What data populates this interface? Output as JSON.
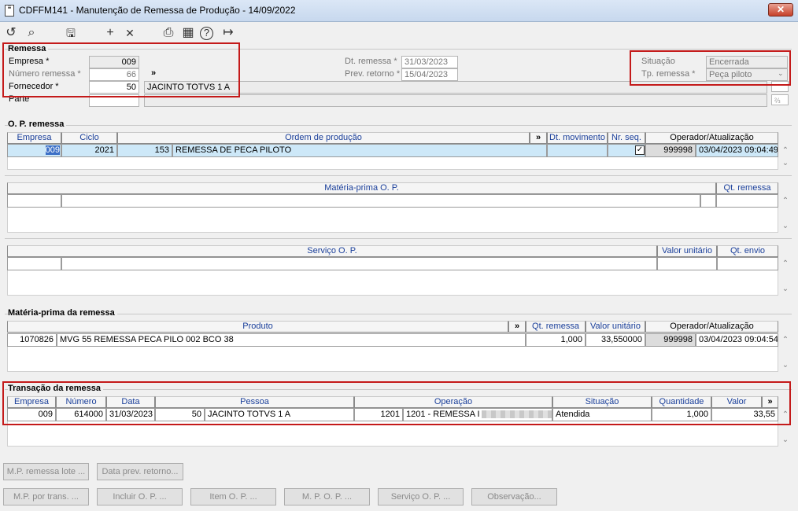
{
  "window": {
    "title": "CDFFM141 - Manutenção de Remessa de Produção - 14/09/2022",
    "close": "✕"
  },
  "toolbar": {
    "undo": "↺",
    "search": "⌕",
    "save": "🖫",
    "add": "+",
    "delete": "✕",
    "print": "⎙",
    "calendar": "▦",
    "help": "?",
    "exit": "↦"
  },
  "remessa": {
    "section": "Remessa",
    "empresa_label": "Empresa *",
    "empresa": "009",
    "numero_label": "Número remessa *",
    "numero": "66",
    "fornecedor_label": "Fornecedor *",
    "fornecedor": "50",
    "fornecedor_nome": "JACINTO TOTVS 1 A",
    "parte_label": "Parte",
    "more": "»",
    "dt_remessa_label": "Dt. remessa *",
    "dt_remessa": "31/03/2023",
    "prev_retorno_label": "Prev. retorno *",
    "prev_retorno": "15/04/2023",
    "situacao_label": "Situação",
    "situacao": "Encerrada",
    "tp_remessa_label": "Tp. remessa *",
    "tp_remessa": "Peça piloto"
  },
  "op_remessa": {
    "section": "O. P. remessa",
    "headers": [
      "Empresa",
      "Ciclo",
      "Ordem de produção",
      "»",
      "Dt. movimento",
      "Nr. seq.",
      "Operador/Atualização"
    ],
    "row": {
      "empresa": "009",
      "ciclo": "2021",
      "ordem": "153",
      "ordem_desc": "REMESSA DE PECA PILOTO",
      "dt_movimento": "",
      "nr_seq_checked": "✓",
      "operador": "999998",
      "atualizacao": "03/04/2023 09:04:49"
    }
  },
  "mp_op": {
    "headers": [
      "Matéria-prima O. P.",
      "Qt. remessa"
    ]
  },
  "servico_op": {
    "headers": [
      "Serviço O. P.",
      "Valor unitário",
      "Qt. envio"
    ]
  },
  "mp_remessa": {
    "section": "Matéria-prima da remessa",
    "headers": [
      "Produto",
      "»",
      "Qt. remessa",
      "Valor unitário",
      "Operador/Atualização"
    ],
    "row": {
      "codigo": "1070826",
      "produto": "MVG 55 REMESSA PECA PILO 002 BCO 38",
      "qt": "1,000",
      "valor": "33,550000",
      "operador": "999998",
      "atualizacao": "03/04/2023 09:04:54"
    }
  },
  "transacao": {
    "section": "Transação da remessa",
    "headers": [
      "Empresa",
      "Número",
      "Data",
      "Pessoa",
      "Operação",
      "Situação",
      "Quantidade",
      "Valor",
      "»"
    ],
    "row": {
      "empresa": "009",
      "numero": "614000",
      "data": "31/03/2023",
      "pessoa_cod": "50",
      "pessoa": "JACINTO TOTVS 1 A",
      "operacao_cod": "1201",
      "operacao": "1201 - REMESSA I",
      "situacao": "Atendida",
      "quantidade": "1,000",
      "valor": "33,55"
    }
  },
  "buttons": {
    "row1": [
      "M.P. remessa lote ...",
      "Data prev. retorno..."
    ],
    "row2": [
      "M.P. por trans. ...",
      "Incluir O. P. ...",
      "Item O. P. ...",
      "M. P. O. P. ...",
      "Serviço O. P. ...",
      "Observação..."
    ]
  }
}
